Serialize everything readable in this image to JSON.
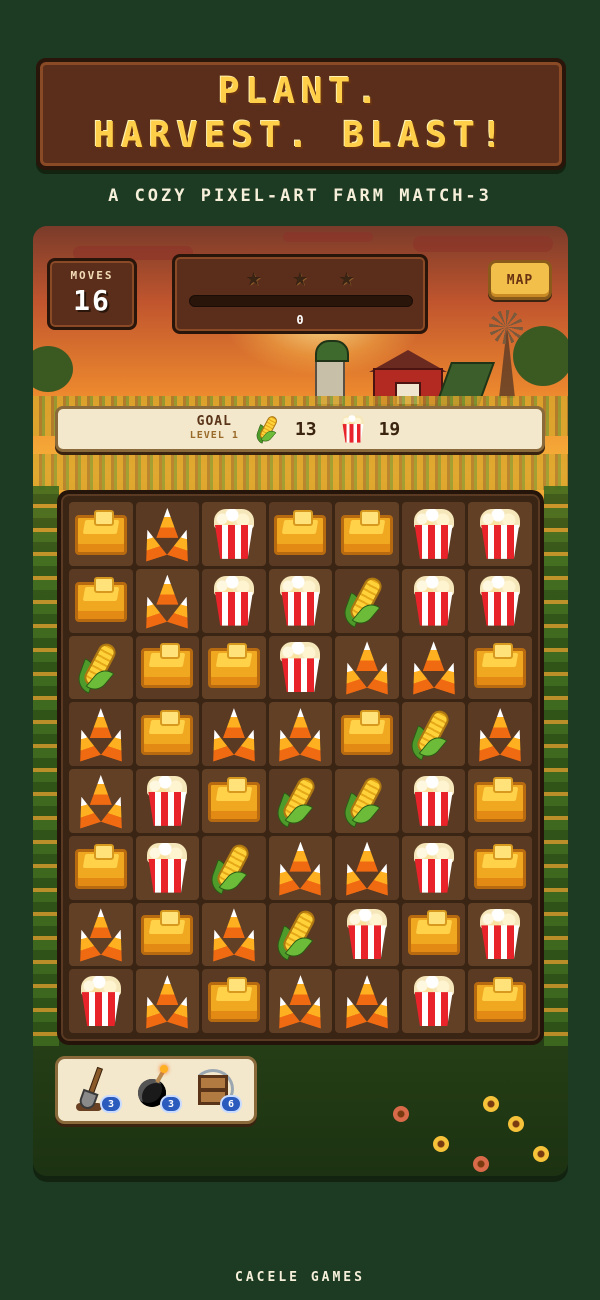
{
  "banner": {
    "line1": "PLANT.",
    "line2": "HARVEST. BLAST!"
  },
  "tagline": "A COZY PIXEL-ART FARM MATCH-3",
  "hud": {
    "moves_label": "MOVES",
    "moves_value": "16",
    "stars_earned": 0,
    "stars_total": 3,
    "progress_fraction": 0,
    "score": "0",
    "map_label": "MAP"
  },
  "goal": {
    "label": "GOAL",
    "level": "LEVEL 1",
    "targets": [
      {
        "icon": "corn",
        "count": "13"
      },
      {
        "icon": "popcorn",
        "count": "19"
      }
    ]
  },
  "board": {
    "rows": 8,
    "cols": 7,
    "tiles": [
      [
        "cornbread",
        "candy",
        "popcorn",
        "cornbread",
        "cornbread",
        "popcorn",
        "popcorn"
      ],
      [
        "cornbread",
        "candy",
        "popcorn",
        "popcorn",
        "corn",
        "popcorn",
        "popcorn"
      ],
      [
        "corn",
        "cornbread",
        "cornbread",
        "popcorn",
        "candy",
        "candy",
        "cornbread"
      ],
      [
        "candy",
        "cornbread",
        "candy",
        "candy",
        "cornbread",
        "corn",
        "candy"
      ],
      [
        "candy",
        "popcorn",
        "cornbread",
        "corn",
        "corn",
        "popcorn",
        "cornbread"
      ],
      [
        "cornbread",
        "popcorn",
        "corn",
        "candy",
        "candy",
        "popcorn",
        "cornbread"
      ],
      [
        "candy",
        "cornbread",
        "candy",
        "corn",
        "popcorn",
        "cornbread",
        "popcorn"
      ],
      [
        "popcorn",
        "candy",
        "cornbread",
        "candy",
        "candy",
        "popcorn",
        "cornbread"
      ]
    ]
  },
  "boosters": [
    {
      "name": "shovel",
      "count": "3"
    },
    {
      "name": "bomb",
      "count": "3"
    },
    {
      "name": "crate-shuffle",
      "count": "6"
    }
  ],
  "credit": "CACELE GAMES"
}
